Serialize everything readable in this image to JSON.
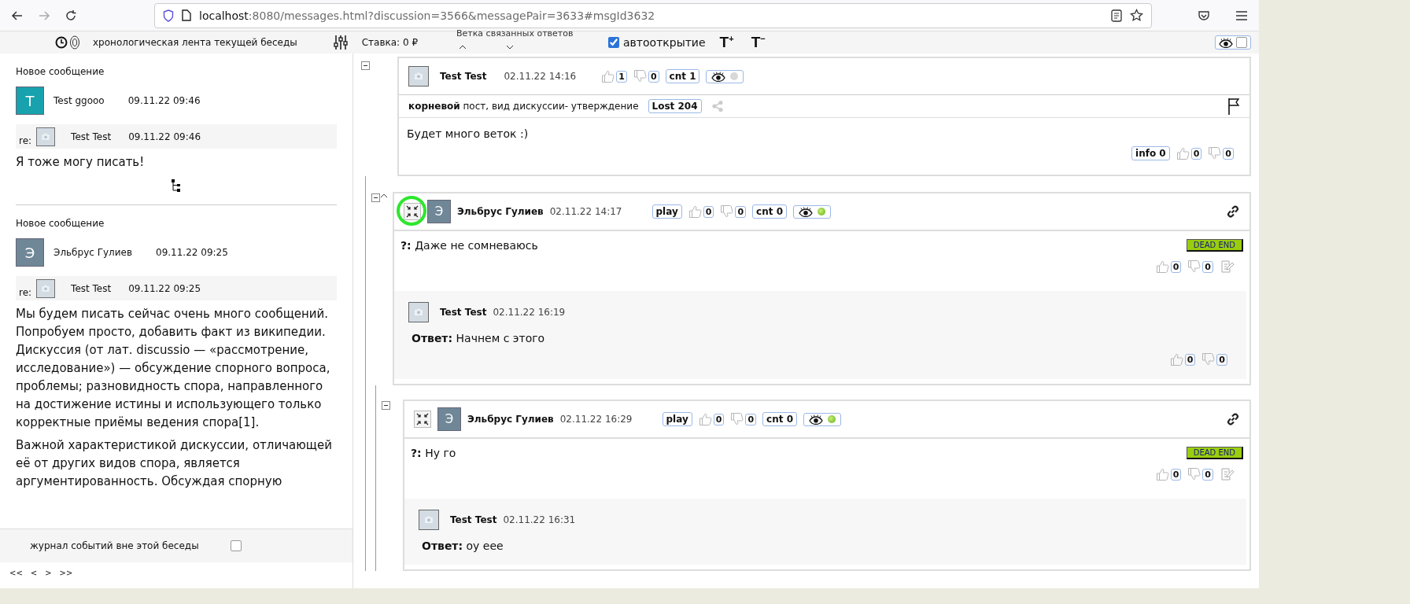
{
  "browser": {
    "url_host": "localhost",
    "url_rest": ":8080/messages.html?discussion=3566&messagePair=3633#msgId3632"
  },
  "header": {
    "timeline_label": "хронологическая лента текущей беседы",
    "stake": "Ставка: 0 ₽",
    "branch_label": "Ветка связанных ответов",
    "autoopen": {
      "label": "автооткрытие",
      "checked": true
    },
    "font_up": "T$^{+}$",
    "font_down": "T$^{−}$",
    "eye_toggle": {
      "checked": false
    }
  },
  "feed": [
    {
      "heading": "Новое сообщение",
      "avatar_letter": "T",
      "color": "#17a2ae",
      "author": "Test ggooo",
      "time": "09.11.22 09:46",
      "reply": {
        "prefix": "re:",
        "author": "Test Test",
        "time": "09.11.22 09:46"
      },
      "paragraphs": [
        "Я тоже могу писать!"
      ],
      "tree_icon": true
    },
    {
      "heading": "Новое сообщение",
      "avatar_letter": "Э",
      "color": "#6f8797",
      "author": "Эльбрус Гулиев",
      "time": "09.11.22 09:25",
      "reply": {
        "prefix": "re:",
        "author": "Test Test",
        "time": "09.11.22 09:25"
      },
      "paragraphs": [
        "Мы будем писать сейчас очень много сообщений. Попробуем просто, добавить факт из википедии. Дискуссия (от лат. discussio — «рассмотрение, исследование») — обсуждение спорного вопроса, проблемы; разновидность спора, направленного на достижение истины и использующего только корректные приёмы ведения спора[1].",
        "Важной характеристикой дискуссии, отличающей её от других видов спора, является аргументированность. Обсуждая спорную"
      ]
    }
  ],
  "event_log": {
    "label": "журнал событий вне этой беседы",
    "checked": false
  },
  "pager": [
    "<<",
    "<",
    ">",
    ">>"
  ],
  "root_post": {
    "author": "Test Test",
    "time": "02.11.22 14:16",
    "likes": "1",
    "dislikes": "0",
    "cnt": "cnt 1",
    "eye": {
      "active": false
    },
    "info": "**корневой** пост, вид дискуссии- утверждение",
    "lost": "Lost 204",
    "body": "Будет много веток :)",
    "info_count": "info 0",
    "body_likes": "0",
    "body_dislikes": "0",
    "children": [
      {
        "annotated": true,
        "avatar_letter": "Э",
        "author": "Эльбрус Гулиев",
        "time": "02.11.22 14:17",
        "play": "play",
        "likes": "0",
        "dislikes": "0",
        "cnt": "cnt 0",
        "eye": {
          "active": true
        },
        "question": "**?:** Даже не сомневаюсь",
        "badge": "DEAD END",
        "q_likes": "0",
        "q_dislikes": "0",
        "answer": {
          "author": "Test Test",
          "time": "02.11.22 16:19",
          "text": "**Ответ:** Начнем с этого",
          "likes": "0",
          "dislikes": "0"
        },
        "children": [
          {
            "annotated": false,
            "avatar_letter": "Э",
            "author": "Эльбрус Гулиев",
            "time": "02.11.22 16:29",
            "play": "play",
            "likes": "0",
            "dislikes": "0",
            "cnt": "cnt 0",
            "eye": {
              "active": true
            },
            "question": "**?:** Ну го",
            "badge": "DEAD END",
            "q_likes": "0",
            "q_dislikes": "0",
            "answer": {
              "author": "Test Test",
              "time": "02.11.22 16:31",
              "text": "**Ответ:** оу еее"
            }
          }
        ]
      }
    ]
  }
}
